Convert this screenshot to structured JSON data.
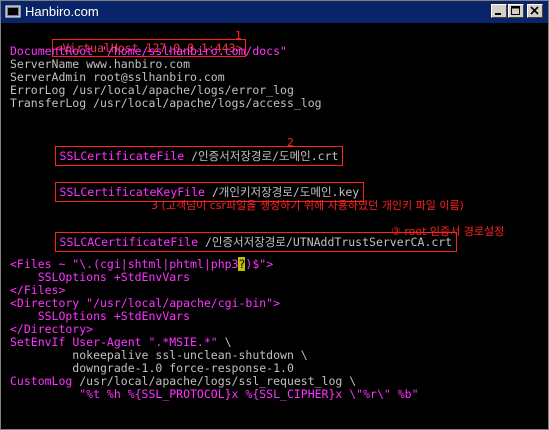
{
  "window": {
    "title": "Hanbiro.com"
  },
  "lines": {
    "vhost_open": "<VirtualHost 127.0.0.1:443>",
    "docroot_key": "DocumentRoot",
    "docroot_val": " \"/home/sslhanbiro.com/docs\"",
    "servername": "ServerName www.hanbiro.com",
    "serveradmin": "ServerAdmin root@sslhanbiro.com",
    "errorlog": "ErrorLog /usr/local/apache/logs/error_log",
    "transferlog": "TransferLog /usr/local/apache/logs/access_log",
    "sslcert_key": "SSLCertificateFile",
    "sslcert_val": " /인증서저장경로/도메인.crt",
    "sslkey_key": "SSLCertificateKeyFile",
    "sslkey_val": " /개인키저장경로/도메인.key",
    "sslca_key": "SSLCACertificateFile",
    "sslca_val": " /인증서저장경로/UTNAddTrustServerCA.crt",
    "files_open_a": "<Files ~ \"\\.(cgi|shtml|phtml|php3",
    "files_cursor": "?",
    "files_open_b": ")$\">",
    "ssloptions1": "    SSLOptions +StdEnvVars",
    "files_close": "</Files>",
    "dir_open_a": "<Directory ",
    "dir_open_b": "\"/usr/local/apache/cgi-bin\"",
    "dir_open_c": ">",
    "ssloptions2": "    SSLOptions +StdEnvVars",
    "dir_close": "</Directory>",
    "setenvif_a": "SetEnvIf ",
    "setenvif_b": "User-Agent \".*MSIE.*\"",
    "setenvif_c": " \\",
    "nokeepalive": "         nokeepalive ssl-unclean-shutdown \\",
    "downgrade": "         downgrade-1.0 force-response-1.0",
    "customlog_a": "CustomLog",
    "customlog_b": " /usr/local/apache/logs/ssl_request_log \\",
    "format": "          \"%t %h %{SSL_PROTOCOL}x %{SSL_CIPHER}x \\\"%r\\\" %b\""
  },
  "annotations": {
    "n1": "1",
    "n2": "2",
    "n3": "3 (고객님이 csr파일을 생성하기 위해 사용하였던 개인키 파일 이름)",
    "n4": "③ root 인증서 경로설정"
  },
  "colors": {
    "titlebar": "#0a246a",
    "terminal_bg": "#000000",
    "red": "#ff3333",
    "magenta": "#ff33ff",
    "grey": "#c0c0c0"
  }
}
